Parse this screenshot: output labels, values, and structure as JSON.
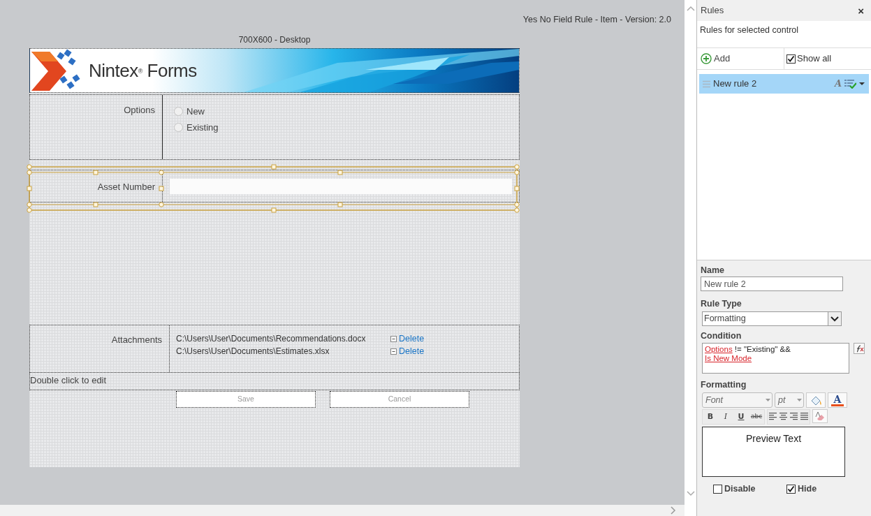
{
  "canvas": {
    "version_label": "Yes No Field Rule - Item - Version: 2.0",
    "layout_label": "700X600 - Desktop"
  },
  "form": {
    "banner_title": "Nintex$^{®}$ Forms",
    "options": {
      "label": "Options",
      "choices": [
        {
          "label": "New",
          "selected": false
        },
        {
          "label": "Existing",
          "selected": false
        }
      ]
    },
    "asset_number": {
      "label": "Asset Number",
      "selected": true
    },
    "attachments": {
      "label": "Attachments",
      "files": [
        {
          "path": "C:\\Users\\User\\Documents\\Recommendations.docx",
          "action": "Delete"
        },
        {
          "path": "C:\\Users\\User\\Documents\\Estimates.xlsx",
          "action": "Delete"
        }
      ]
    },
    "footer_text": "Double click to edit",
    "buttons": [
      {
        "label": "Save",
        "disabled": true
      },
      {
        "label": "Cancel",
        "disabled": true
      }
    ]
  },
  "rules_panel": {
    "title": "Rules",
    "close": "×",
    "subtitle": "Rules for selected control",
    "add_label": "Add",
    "show_all": {
      "label": "Show all",
      "checked": true
    },
    "rules": [
      {
        "name": "New rule 2",
        "selected": true,
        "type_glyph": "A"
      }
    ],
    "name_label": "Name",
    "name_value": "New rule 2",
    "rule_type_label": "Rule Type",
    "rule_type_value": "Formatting",
    "condition_label": "Condition",
    "condition": [
      [
        {
          "kind": "reference",
          "text": "Options"
        },
        {
          "kind": "text",
          "text": " != \"Existing\" &&"
        }
      ],
      [
        {
          "kind": "reference",
          "text": "Is New Mode"
        }
      ]
    ],
    "formatting_label": "Formatting",
    "font_placeholder": "Font",
    "size_placeholder": "pt",
    "font_color_glyph": "A",
    "style_buttons": [
      {
        "kind": "bold",
        "text": "B"
      },
      {
        "kind": "italic",
        "text": "I"
      },
      {
        "kind": "underline",
        "text": "U"
      },
      {
        "kind": "strike",
        "text": "abc"
      }
    ],
    "preview": "Preview Text",
    "disable": {
      "label": "Disable",
      "checked": false
    },
    "hide": {
      "label": "Hide",
      "checked": true
    }
  }
}
